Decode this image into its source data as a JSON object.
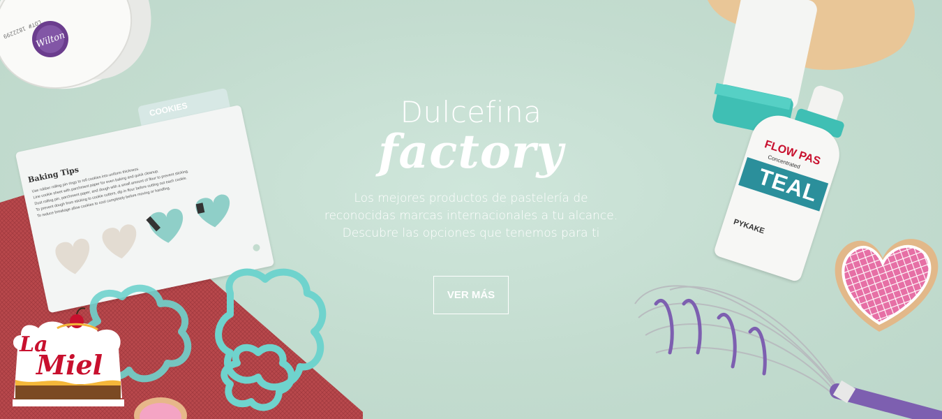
{
  "hero": {
    "brand_line1": "Dulcefina",
    "brand_line2": "factory",
    "tagline": [
      "Los mejores productos de pastelería de",
      "reconocidas marcas internacionales a tu alcance.",
      "Descubre las opciones que tenemos para ti"
    ],
    "cta_label": "VER MÁS"
  },
  "logo": {
    "line1": "La",
    "line2": "Miel"
  },
  "props": {
    "container_brand": "Wilton",
    "container_lot": "LOT# 1822299",
    "card_tab": "COOKIES",
    "card_title": "Baking Tips",
    "card_tips": [
      "Use rubber rolling pin rings to roll cookies into uniform thickness.",
      "Line cookie sheet with parchment paper for even baking and quick cleanup.",
      "Dust rolling pin, parchment paper, and dough with a small amount of flour to prevent sticking.",
      "To prevent dough from sticking to cookie cutters, dip in flour before cutting out each cookie.",
      "To reduce breakage allow cookies to cool completely before moving or handling."
    ],
    "bottle_label_line1": "FLOW PAS",
    "bottle_label_line2": "Concentrated",
    "bottle_color_label": "TEAL",
    "bottle_brand": "PYKAKE"
  },
  "colors": {
    "background": "#c4ddd0",
    "teal": "#3fbfb4",
    "purple": "#7d5fb0",
    "logo_red": "#c8102e",
    "cookie_pink": "#e66fa5"
  }
}
